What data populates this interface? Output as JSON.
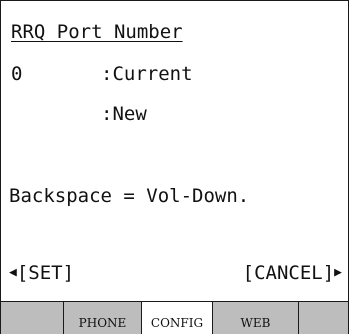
{
  "screen": {
    "title": "RRQ Port Number",
    "value": "0",
    "current_label": ":Current",
    "new_label": ":New",
    "hint": "Backspace = Vol-Down."
  },
  "softkeys": {
    "left_label": "[SET]",
    "right_label": "[CANCEL]",
    "left_icon": "triangle-left-icon",
    "right_icon": "triangle-right-icon"
  },
  "tabs": [
    {
      "label": "",
      "active": false
    },
    {
      "label": "PHONE",
      "active": false
    },
    {
      "label": "CONFIG",
      "active": true
    },
    {
      "label": "WEB",
      "active": false
    },
    {
      "label": "",
      "active": false
    }
  ],
  "colors": {
    "background": "#ffffff",
    "text": "#111111",
    "tab_inactive": "#bdbdbd",
    "tab_active": "#ffffff"
  }
}
